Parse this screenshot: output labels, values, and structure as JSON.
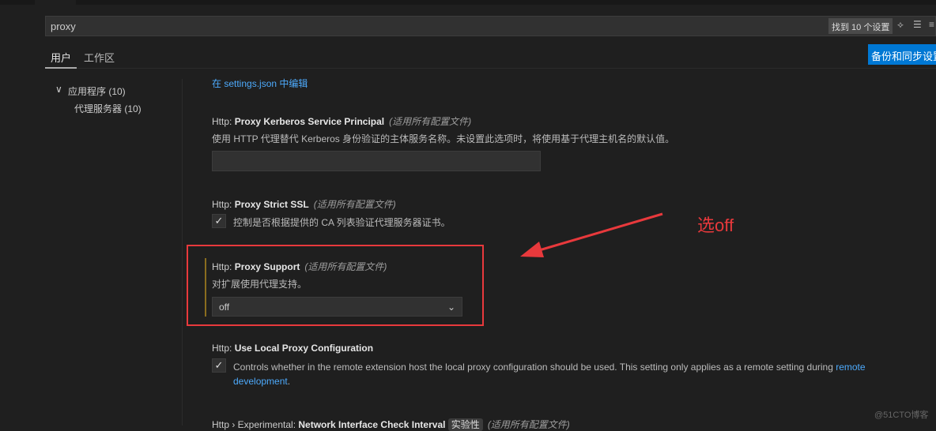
{
  "search": {
    "value": "proxy",
    "result_count": "找到 10 个设置"
  },
  "tabs": [
    {
      "label": "用户",
      "active": true
    },
    {
      "label": "工作区",
      "active": false
    }
  ],
  "sync_button": "备份和同步设置",
  "tree": [
    {
      "label": "应用程序 (10)"
    },
    {
      "label": "代理服务器 (10)"
    }
  ],
  "edit_link": "在 settings.json 中编辑",
  "settings": [
    {
      "prefix": "Http: ",
      "name": "Proxy Kerberos Service Principal",
      "scope": "(适用所有配置文件)",
      "desc": "使用 HTTP 代理替代 Kerberos 身份验证的主体服务名称。未设置此选项时，将使用基于代理主机名的默认值。",
      "value": ""
    },
    {
      "prefix": "Http: ",
      "name": "Proxy Strict SSL",
      "scope": "(适用所有配置文件)",
      "desc": "控制是否根据提供的 CA 列表验证代理服务器证书。",
      "checked": true
    },
    {
      "prefix": "Http: ",
      "name": "Proxy Support",
      "scope": "(适用所有配置文件)",
      "desc": "对扩展使用代理支持。",
      "value": "off"
    },
    {
      "prefix": "Http: ",
      "name": "Use Local Proxy Configuration",
      "desc": "Controls whether in the remote extension host the local proxy configuration should be used. This setting only applies as a remote setting during ",
      "link": "remote development",
      "after": ".",
      "checked": true
    },
    {
      "prefix": "Http › Experimental: ",
      "name": "Network Interface Check Interval",
      "badge": "实验性",
      "scope": "(适用所有配置文件)"
    }
  ],
  "annotation": "选off",
  "watermark": "@51CTO博客",
  "colors": {
    "accent": "#0078d4",
    "annotation": "#e8393c"
  }
}
